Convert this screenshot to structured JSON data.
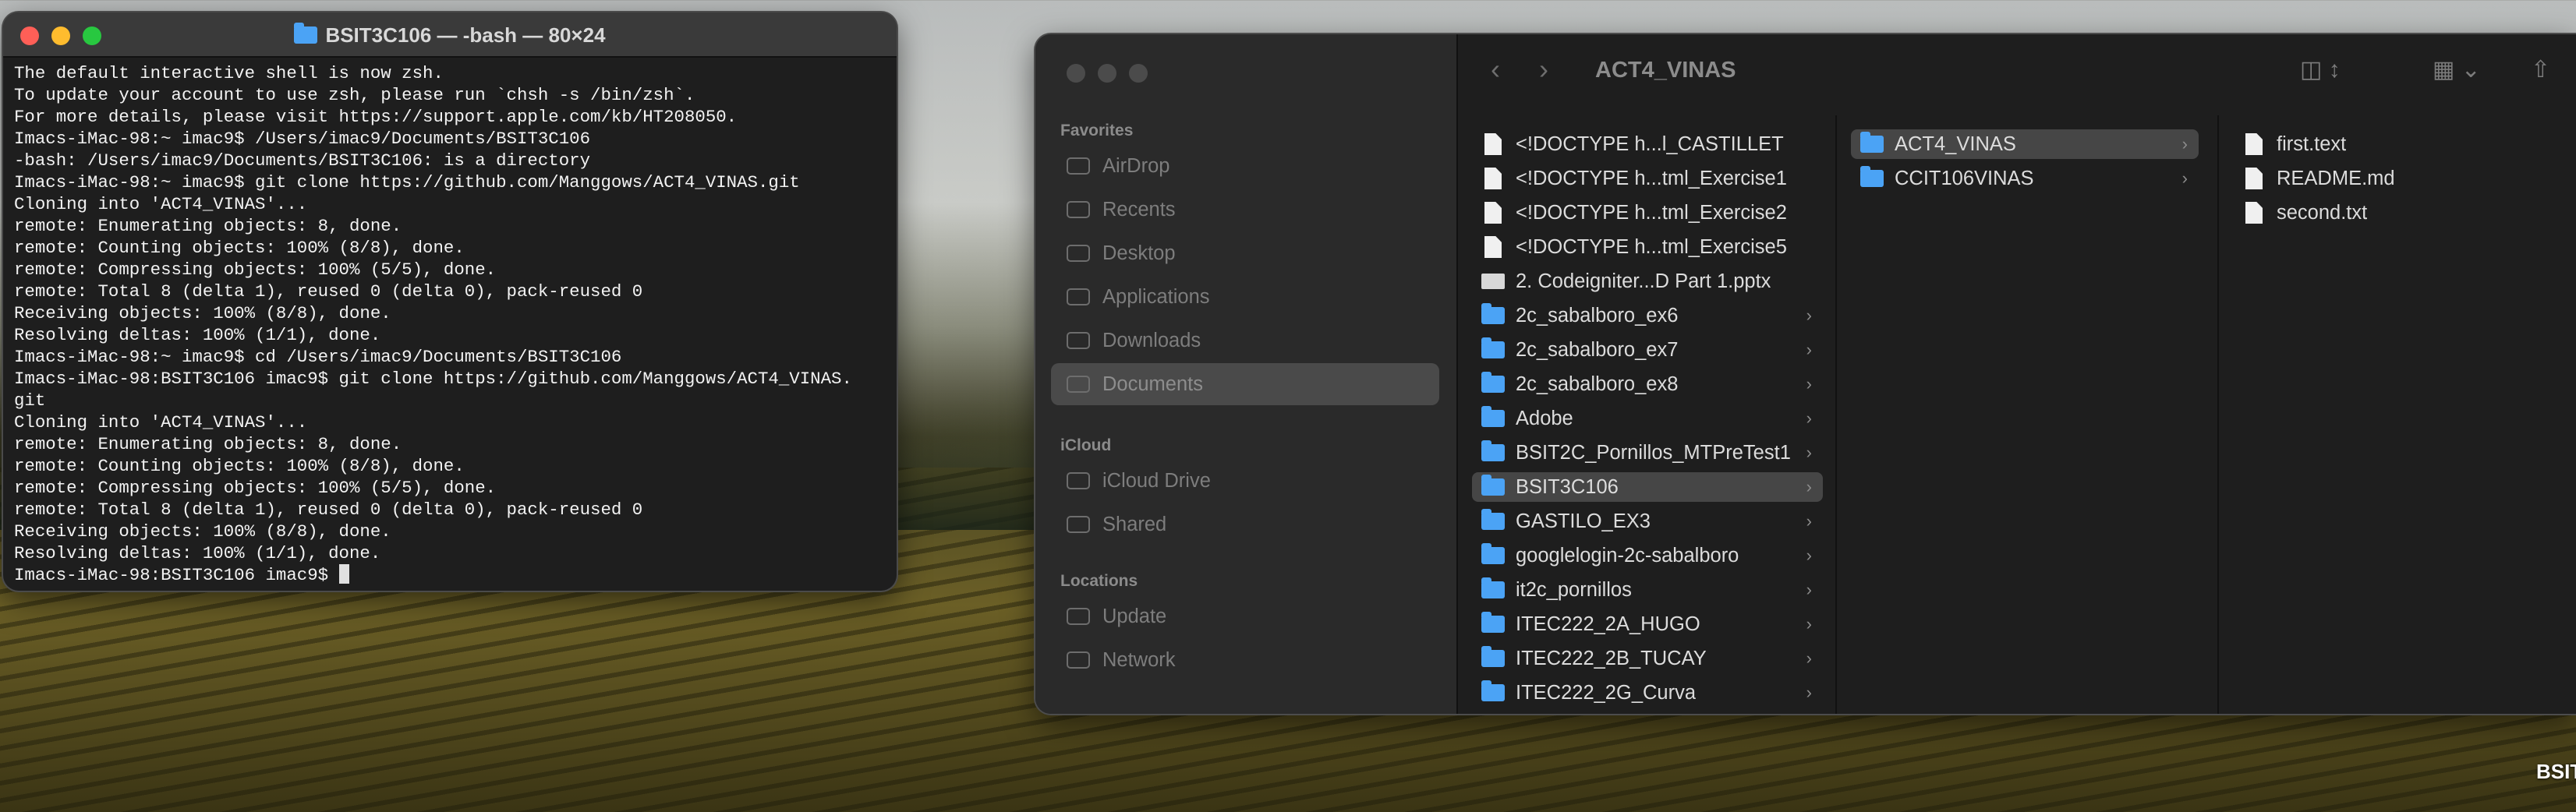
{
  "desktop": {
    "label": "BSIT"
  },
  "terminal": {
    "title": "BSIT3C106 — -bash — 80×24",
    "lines": [
      "The default interactive shell is now zsh.",
      "To update your account to use zsh, please run `chsh -s /bin/zsh`.",
      "For more details, please visit https://support.apple.com/kb/HT208050.",
      "Imacs-iMac-98:~ imac9$ /Users/imac9/Documents/BSIT3C106",
      "-bash: /Users/imac9/Documents/BSIT3C106: is a directory",
      "Imacs-iMac-98:~ imac9$ git clone https://github.com/Manggows/ACT4_VINAS.git",
      "Cloning into 'ACT4_VINAS'...",
      "remote: Enumerating objects: 8, done.",
      "remote: Counting objects: 100% (8/8), done.",
      "remote: Compressing objects: 100% (5/5), done.",
      "remote: Total 8 (delta 1), reused 0 (delta 0), pack-reused 0",
      "Receiving objects: 100% (8/8), done.",
      "Resolving deltas: 100% (1/1), done.",
      "Imacs-iMac-98:~ imac9$ cd /Users/imac9/Documents/BSIT3C106",
      "Imacs-iMac-98:BSIT3C106 imac9$ git clone https://github.com/Manggows/ACT4_VINAS.",
      "git",
      "Cloning into 'ACT4_VINAS'...",
      "remote: Enumerating objects: 8, done.",
      "remote: Counting objects: 100% (8/8), done.",
      "remote: Compressing objects: 100% (5/5), done.",
      "remote: Total 8 (delta 1), reused 0 (delta 0), pack-reused 0",
      "Receiving objects: 100% (8/8), done.",
      "Resolving deltas: 100% (1/1), done."
    ],
    "prompt": "Imacs-iMac-98:BSIT3C106 imac9$ "
  },
  "finder": {
    "title": "ACT4_VINAS",
    "sidebar": {
      "favorites_header": "Favorites",
      "favorites": [
        {
          "label": "AirDrop",
          "icon": "airdrop-icon"
        },
        {
          "label": "Recents",
          "icon": "clock-icon"
        },
        {
          "label": "Desktop",
          "icon": "desktop-icon"
        },
        {
          "label": "Applications",
          "icon": "applications-icon"
        },
        {
          "label": "Downloads",
          "icon": "download-icon"
        },
        {
          "label": "Documents",
          "icon": "document-icon",
          "active": true
        }
      ],
      "icloud_header": "iCloud",
      "icloud": [
        {
          "label": "iCloud Drive",
          "icon": "cloud-icon"
        },
        {
          "label": "Shared",
          "icon": "shared-folder-icon"
        }
      ],
      "locations_header": "Locations",
      "locations": [
        {
          "label": "Update",
          "icon": "disk-icon"
        },
        {
          "label": "Network",
          "icon": "network-icon"
        }
      ]
    },
    "column1": [
      {
        "name": "<!DOCTYPE h...l_CASTILLET",
        "kind": "doc"
      },
      {
        "name": "<!DOCTYPE h...tml_Exercise1",
        "kind": "doc"
      },
      {
        "name": "<!DOCTYPE h...tml_Exercise2",
        "kind": "doc"
      },
      {
        "name": "<!DOCTYPE h...tml_Exercise5",
        "kind": "doc"
      },
      {
        "name": "2. Codeigniter...D Part 1.pptx",
        "kind": "ppt"
      },
      {
        "name": "2c_sabalboro_ex6",
        "kind": "folder"
      },
      {
        "name": "2c_sabalboro_ex7",
        "kind": "folder"
      },
      {
        "name": "2c_sabalboro_ex8",
        "kind": "folder"
      },
      {
        "name": "Adobe",
        "kind": "folder"
      },
      {
        "name": "BSIT2C_Pornillos_MTPreTest1",
        "kind": "folder"
      },
      {
        "name": "BSIT3C106",
        "kind": "folder",
        "selected": true
      },
      {
        "name": "GASTILO_EX3",
        "kind": "folder"
      },
      {
        "name": "googlelogin-2c-sabalboro",
        "kind": "folder"
      },
      {
        "name": "it2c_pornillos",
        "kind": "folder"
      },
      {
        "name": "ITEC222_2A_HUGO",
        "kind": "folder"
      },
      {
        "name": "ITEC222_2B_TUCAY",
        "kind": "folder"
      },
      {
        "name": "ITEC222_2G_Curva",
        "kind": "folder"
      }
    ],
    "column2": [
      {
        "name": "ACT4_VINAS",
        "kind": "folder",
        "selected": true
      },
      {
        "name": "CCIT106VINAS",
        "kind": "folder"
      }
    ],
    "column3": [
      {
        "name": "first.text",
        "kind": "doc"
      },
      {
        "name": "README.md",
        "kind": "doc"
      },
      {
        "name": "second.txt",
        "kind": "doc"
      }
    ]
  }
}
